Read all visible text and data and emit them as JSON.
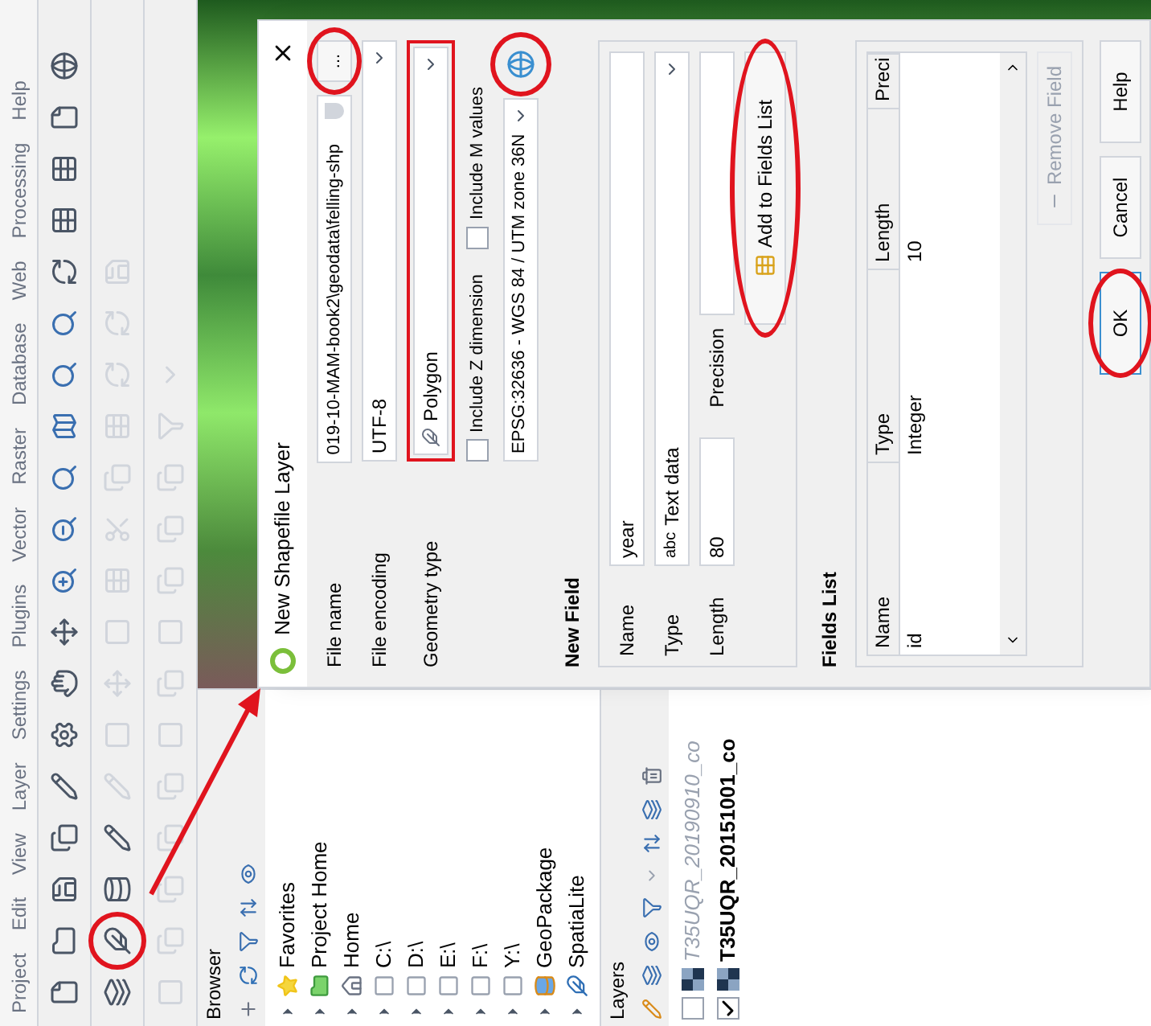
{
  "menu": [
    "Project",
    "Edit",
    "View",
    "Layer",
    "Settings",
    "Plugins",
    "Vector",
    "Raster",
    "Database",
    "Web",
    "Processing",
    "Help"
  ],
  "browser": {
    "title": "Browser",
    "items": [
      {
        "label": "Favorites",
        "kind": "star"
      },
      {
        "label": "Project Home",
        "kind": "project"
      },
      {
        "label": "Home",
        "kind": "home"
      },
      {
        "label": "C:\\",
        "kind": "drive"
      },
      {
        "label": "D:\\",
        "kind": "drive"
      },
      {
        "label": "E:\\",
        "kind": "drive"
      },
      {
        "label": "F:\\",
        "kind": "drive"
      },
      {
        "label": "Y:\\",
        "kind": "drive"
      },
      {
        "label": "GeoPackage",
        "kind": "geopackage"
      },
      {
        "label": "SpatiaLite",
        "kind": "spatialite"
      }
    ]
  },
  "layers": {
    "title": "Layers",
    "items": [
      {
        "name": "T35UQR_20190910_co",
        "checked": false
      },
      {
        "name": "T35UQR_20151001_co",
        "checked": true
      }
    ]
  },
  "dialog": {
    "title": "New Shapefile Layer",
    "file_name": {
      "label": "File name",
      "value": "019-10-MAM-book2\\geodata\\felling-shp",
      "button": "..."
    },
    "file_encoding": {
      "label": "File encoding",
      "value": "UTF-8"
    },
    "geometry_type": {
      "label": "Geometry type",
      "value": "Polygon"
    },
    "options": [
      {
        "label": "Include Z dimension",
        "checked": false
      },
      {
        "label": "Include M values",
        "checked": false
      }
    ],
    "crs": {
      "value": "EPSG:32636 - WGS 84 / UTM zone 36N"
    },
    "new_field": {
      "title": "New Field",
      "name_label": "Name",
      "name_value": "year",
      "type_label": "Type",
      "type_prefix": "abc",
      "type_value": "Text data",
      "length_label": "Length",
      "length_value": "80",
      "precision_label": "Precision",
      "add_button": "Add to Fields List"
    },
    "fields_list": {
      "title": "Fields List",
      "columns": [
        "Name",
        "Type",
        "Length",
        "Preci"
      ],
      "fields": [
        {
          "name": "id",
          "type": "Integer",
          "length": "10"
        }
      ]
    },
    "remove_button": {
      "label": "Remove Field",
      "disabled": true
    },
    "buttons": [
      "OK",
      "Cancel",
      "Help"
    ]
  }
}
